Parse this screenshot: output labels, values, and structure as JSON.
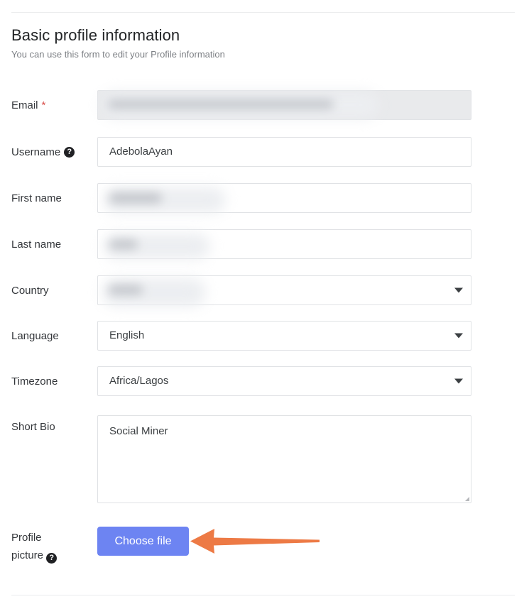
{
  "section": {
    "title": "Basic profile information",
    "description": "You can use this form to edit your Profile information"
  },
  "fields": {
    "email": {
      "label": "Email",
      "required_marker": "*",
      "value": "",
      "redacted": true,
      "disabled": true
    },
    "username": {
      "label": "Username",
      "help_icon": "help-icon",
      "value": "AdebolaAyan"
    },
    "first_name": {
      "label": "First name",
      "value": "",
      "redacted": true
    },
    "last_name": {
      "label": "Last name",
      "value": "",
      "redacted": true
    },
    "country": {
      "label": "Country",
      "value": "",
      "redacted": true,
      "arrow_icon": "chevron-down-icon"
    },
    "language": {
      "label": "Language",
      "value": "English",
      "arrow_icon": "chevron-down-icon"
    },
    "timezone": {
      "label": "Timezone",
      "value": "Africa/Lagos",
      "arrow_icon": "chevron-down-icon"
    },
    "short_bio": {
      "label": "Short Bio",
      "value": "Social Miner"
    },
    "profile_picture": {
      "label_line1": "Profile",
      "label_line2": "picture",
      "help_icon": "help-icon",
      "button_label": "Choose file"
    }
  },
  "annotation": {
    "type": "arrow-pointing-left",
    "target": "Choose file",
    "color": "#ed7a45"
  },
  "colors": {
    "button": "#6d84f2",
    "required_star": "#d9534f",
    "label_text": "#33363a",
    "muted_text": "#7d8085",
    "border": "#e0e2e5",
    "disabled_bg": "#e9eaec",
    "annotation": "#ed7a45"
  }
}
